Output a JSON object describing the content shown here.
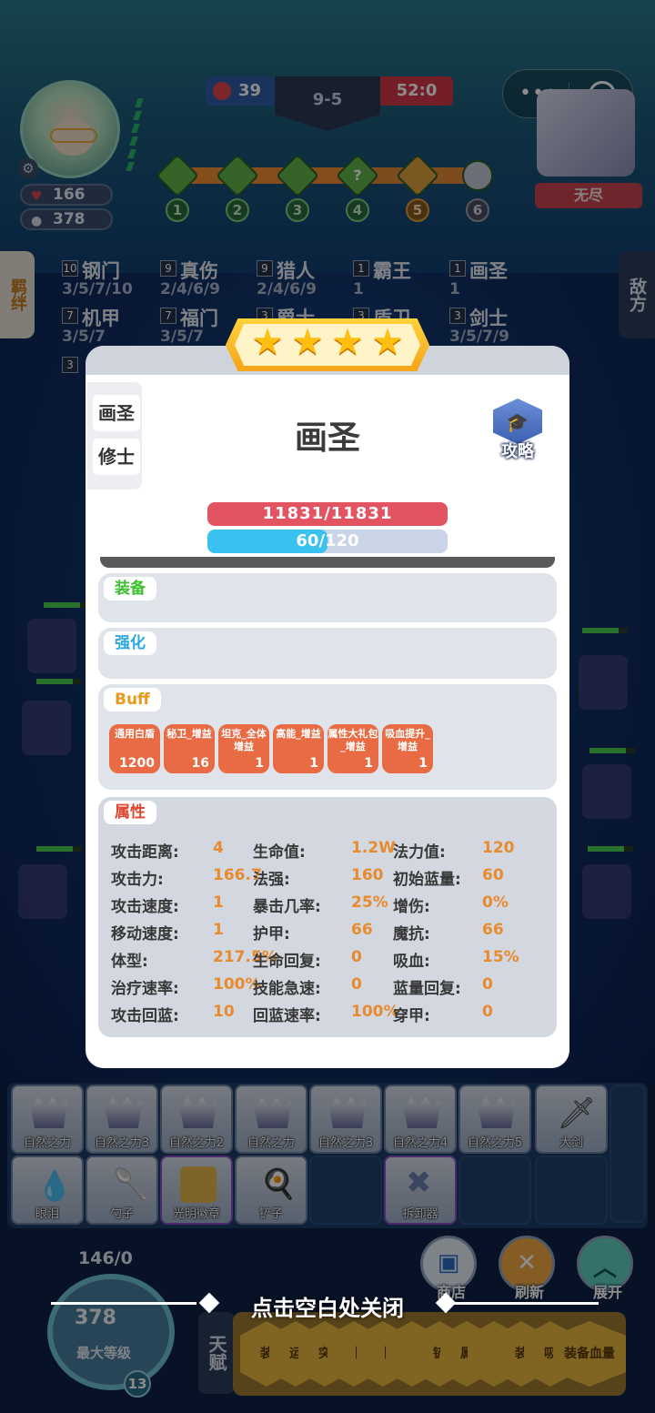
{
  "hud": {
    "hp": "166",
    "coins": "378",
    "score_left": "39",
    "round": "9-5",
    "timer": "52:0",
    "enemy_label": "无尽",
    "stage_nodes": [
      "1",
      "2",
      "3",
      "4",
      "5",
      "6"
    ],
    "stage_node_mark": "?"
  },
  "traits": {
    "left_tab": "羁绊",
    "right_tab": "敌方",
    "items": [
      {
        "count": "10",
        "name": "钢门",
        "levels": "3/5/7/10"
      },
      {
        "count": "9",
        "name": "真伤",
        "levels": "2/4/6/9"
      },
      {
        "count": "9",
        "name": "猎人",
        "levels": "2/4/6/9"
      },
      {
        "count": "1",
        "name": "霸王",
        "levels": "1"
      },
      {
        "count": "1",
        "name": "画圣",
        "levels": "1"
      },
      {
        "count": "7",
        "name": "机甲",
        "levels": "3/5/7"
      },
      {
        "count": "7",
        "name": "福门",
        "levels": "3/5/7"
      },
      {
        "count": "3",
        "name": "爵士",
        "levels": ""
      },
      {
        "count": "3",
        "name": "盾卫",
        "levels": ""
      },
      {
        "count": "3",
        "name": "剑士",
        "levels": "3/5/7/9"
      }
    ],
    "third_row_count": "3"
  },
  "modal": {
    "stars": 4,
    "tags": [
      "画圣",
      "修士"
    ],
    "name": "画圣",
    "guide_label": "攻略",
    "hp_text": "11831/11831",
    "mp_text": "60/120",
    "mp_fraction": 0.5,
    "sections": {
      "equip": "装备",
      "enhance": "强化",
      "buff": "Buff",
      "attributes": "属性"
    },
    "buffs": [
      {
        "name": "通用白盾",
        "value": "1200"
      },
      {
        "name": "秘卫_增益",
        "value": "16"
      },
      {
        "name": "坦克_全体增益",
        "value": "1"
      },
      {
        "name": "高能_增益",
        "value": "1"
      },
      {
        "name": "属性大礼包_增益",
        "value": "1"
      },
      {
        "name": "吸血提升_增益",
        "value": "1"
      }
    ],
    "attributes": [
      [
        {
          "k": "攻击距离:",
          "v": "4"
        },
        {
          "k": "生命值:",
          "v": "1.2W"
        },
        {
          "k": "法力值:",
          "v": "120"
        }
      ],
      [
        {
          "k": "攻击力:",
          "v": "166.7"
        },
        {
          "k": "法强:",
          "v": "160"
        },
        {
          "k": "初始蓝量:",
          "v": "60"
        }
      ],
      [
        {
          "k": "攻击速度:",
          "v": "1"
        },
        {
          "k": "暴击几率:",
          "v": "25%"
        },
        {
          "k": "增伤:",
          "v": "0%"
        }
      ],
      [
        {
          "k": "移动速度:",
          "v": "1"
        },
        {
          "k": "护甲:",
          "v": "66"
        },
        {
          "k": "魔抗:",
          "v": "66"
        }
      ],
      [
        {
          "k": "体型:",
          "v": "217.5%"
        },
        {
          "k": "生命回复:",
          "v": "0"
        },
        {
          "k": "吸血:",
          "v": "15%"
        }
      ],
      [
        {
          "k": "治疗速率:",
          "v": "100%"
        },
        {
          "k": "技能急速:",
          "v": "0"
        },
        {
          "k": "蓝量回复:",
          "v": "0"
        }
      ],
      [
        {
          "k": "攻击回蓝:",
          "v": "10"
        },
        {
          "k": "回蓝速率:",
          "v": "100%"
        },
        {
          "k": "穿甲:",
          "v": "0"
        }
      ]
    ]
  },
  "bench": {
    "row1": [
      "自然之力",
      "自然之力3",
      "自然之力2",
      "自然之力",
      "自然之力3",
      "自然之力4",
      "自然之力5",
      "大剑"
    ],
    "row2": [
      "眼泪",
      "勺子",
      "光明徽章",
      "铲子",
      "",
      "拆卸器",
      "",
      ""
    ]
  },
  "bottom": {
    "exp": "146/0",
    "coins": "378",
    "max_level_label": "最大等级",
    "level": "13",
    "close_hint": "点击空白处关闭",
    "shop_label": "商店",
    "refresh_label": "刷新",
    "expand_label": "展开",
    "talent_label": "天赋",
    "cards": [
      "装",
      "运",
      "突",
      "【",
      "【",
      "【",
      "铲",
      "属",
      "【",
      "【",
      "装",
      "吸",
      "装备血量"
    ]
  }
}
